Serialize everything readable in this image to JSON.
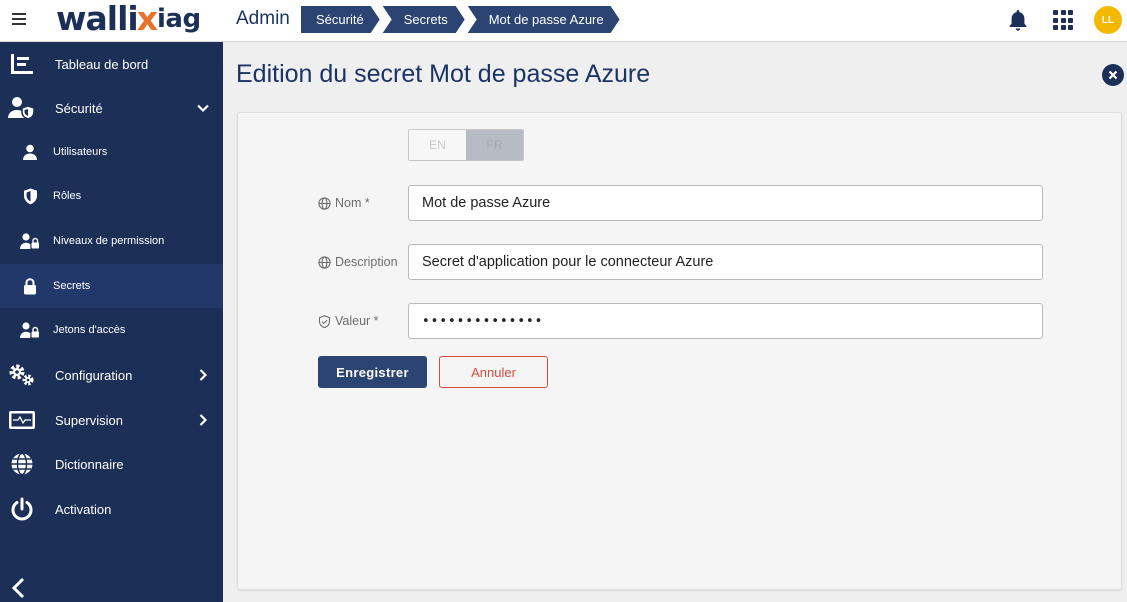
{
  "header": {
    "logo": {
      "part1": "walli",
      "part2": "x",
      "part3": "iag"
    },
    "section_title": "Admin",
    "breadcrumb": [
      "Sécurité",
      "Secrets",
      "Mot de passe Azure"
    ],
    "avatar_initials": "LL"
  },
  "sidebar": {
    "items": [
      {
        "label": "Tableau de bord",
        "icon": "dashboard-icon"
      },
      {
        "label": "Sécurité",
        "icon": "user-shield-icon",
        "expanded": true
      },
      {
        "label": "Utilisateurs",
        "icon": "user-icon",
        "sub": true
      },
      {
        "label": "Rôles",
        "icon": "shield-icon",
        "sub": true
      },
      {
        "label": "Niveaux de permission",
        "icon": "user-lock-icon",
        "sub": true
      },
      {
        "label": "Secrets",
        "icon": "lock-icon",
        "sub": true,
        "active": true
      },
      {
        "label": "Jetons d'accès",
        "icon": "user-key-icon",
        "sub": true
      },
      {
        "label": "Configuration",
        "icon": "gears-icon"
      },
      {
        "label": "Supervision",
        "icon": "monitor-icon"
      },
      {
        "label": "Dictionnaire",
        "icon": "globe-icon"
      },
      {
        "label": "Activation",
        "icon": "power-icon"
      }
    ]
  },
  "main": {
    "title": "Edition du secret Mot de passe Azure",
    "languages": [
      "EN",
      "FR"
    ],
    "selected_language": "FR",
    "fields": {
      "name": {
        "label": "Nom *",
        "value": "Mot de passe Azure"
      },
      "description": {
        "label": "Description",
        "value": "Secret d'application pour le connecteur Azure"
      },
      "value": {
        "label": "Valeur *",
        "value": "••••••••••••••"
      }
    },
    "save_label": "Enregistrer",
    "cancel_label": "Annuler"
  },
  "colors": {
    "navy": "#1b2f57",
    "breadcrumb": "#2b4472",
    "accent_orange": "#e8732a",
    "avatar": "#f5b800",
    "cancel_red": "#d64b3c"
  }
}
